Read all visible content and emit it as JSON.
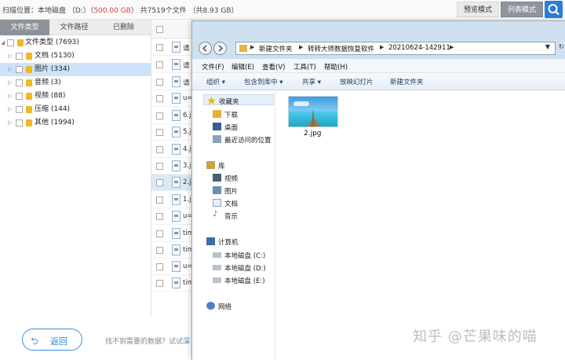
{
  "topbar": {
    "scan_prefix": "扫描位置：本地磁盘 （D:）（",
    "scan_size": "500.00 GB",
    "scan_suffix": "） 共7519个文件 （共8.93 GB）",
    "preview_mode": "预览模式",
    "list_mode": "列表模式",
    "search_icon": "search-icon"
  },
  "tabs": [
    "文件类型",
    "文件路径",
    "已删除"
  ],
  "tree": [
    {
      "label": "文件类型 (7693)",
      "expanded": true
    },
    {
      "label": "文档 (5130)"
    },
    {
      "label": "图片 (334)",
      "selected": true
    },
    {
      "label": "音频 (3)"
    },
    {
      "label": "视频 (88)"
    },
    {
      "label": "压缩 (144)"
    },
    {
      "label": "其他 (1994)"
    }
  ],
  "files": [
    "请",
    "请",
    "请",
    "u=",
    "6.j",
    "5.j",
    "4.j",
    "3.j",
    "2.j",
    "1.j",
    "u=",
    "tim",
    "tim",
    "u=",
    "tim"
  ],
  "bottom": {
    "back_label": "返回",
    "hint": "找不到需要的数据？试试",
    "hint_link": "深"
  },
  "explorer": {
    "path": [
      "新建文件夹",
      "转转大师数据恢复软件",
      "20210624-142911"
    ],
    "menu": [
      "文件(F)",
      "编辑(E)",
      "查看(V)",
      "工具(T)",
      "帮助(H)"
    ],
    "toolbar": [
      "组织 ▾",
      "包含到库中 ▾",
      "共享 ▾",
      "放映幻灯片",
      "新建文件夹"
    ],
    "nav": {
      "favorites": "收藏夹",
      "fav_items": [
        "下载",
        "桌面",
        "最近访问的位置"
      ],
      "library": "库",
      "lib_items": [
        "视频",
        "图片",
        "文档",
        "音乐"
      ],
      "computer": "计算机",
      "drives": [
        "本地磁盘 (C:)",
        "本地磁盘 (D:)",
        "本地磁盘 (E:)"
      ],
      "network": "网络"
    },
    "file_name": "2.jpg"
  },
  "watermark": "知乎 @芒果味的喵",
  "colors": {
    "accent": "#2f85dd",
    "red": "#e23b3b",
    "tab_active": "#8b9299"
  }
}
